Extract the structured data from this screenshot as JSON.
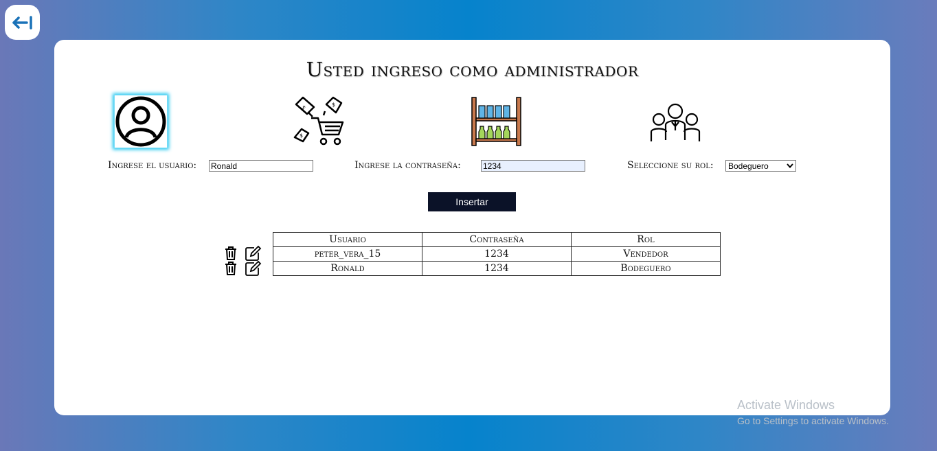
{
  "header": {
    "title": "Usted ingreso como administrador"
  },
  "form": {
    "user_label": "Ingrese el usuario:",
    "user_value": "Ronald",
    "password_label": "Ingrese la contraseña:",
    "password_value": "1234",
    "role_label": "Seleccione su rol:",
    "role_selected": "Bodeguero",
    "insert_label": "Insertar"
  },
  "icons": {
    "back": "back-arrow-icon",
    "user": "user-avatar-icon",
    "shop": "shopping-cart-icon",
    "shelf": "shelf-icon",
    "people": "people-group-icon",
    "delete": "trash-icon",
    "edit": "edit-pencil-icon"
  },
  "table": {
    "headers": [
      "Usuario",
      "Contraseña",
      "Rol"
    ],
    "rows": [
      [
        "peter_vera_15",
        "1234",
        "Vendedor"
      ],
      [
        "Ronald",
        "1234",
        "Bodeguero"
      ]
    ]
  },
  "watermark": {
    "line1": "Activate Windows",
    "line2": "Go to Settings to activate Windows."
  },
  "colors": {
    "accent": "#0683cc",
    "button": "#0b1228",
    "glow": "#23c6f0"
  }
}
